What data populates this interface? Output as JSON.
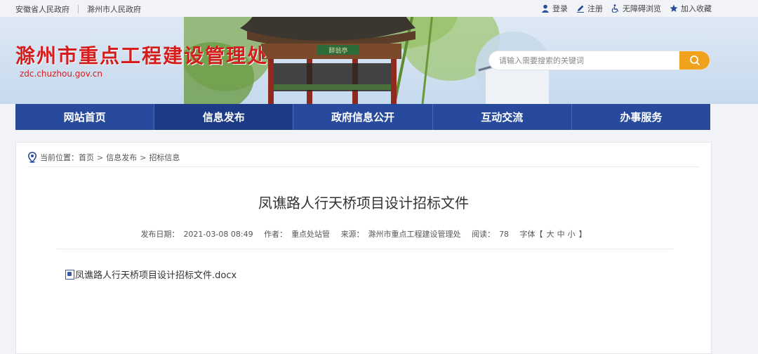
{
  "topbar": {
    "links_left": [
      "安徽省人民政府",
      "滁州市人民政府"
    ],
    "links_right": [
      {
        "label": "登录",
        "icon": "user-icon"
      },
      {
        "label": "注册",
        "icon": "pencil-icon"
      },
      {
        "label": "无障碍浏览",
        "icon": "accessibility-icon"
      },
      {
        "label": "加入收藏",
        "icon": "star-icon"
      }
    ]
  },
  "header": {
    "title": "滁州市重点工程建设管理处",
    "url": "zdc.chuzhou.gov.cn",
    "banner_sign": "醉翁亭",
    "search_placeholder": "请输入需要搜索的关键词"
  },
  "nav": {
    "items": [
      "网站首页",
      "信息发布",
      "政府信息公开",
      "互动交流",
      "办事服务"
    ],
    "active": "信息发布"
  },
  "breadcrumb": {
    "prefix": "当前位置：",
    "items": [
      "首页",
      "信息发布",
      "招标信息"
    ],
    "sep": ">"
  },
  "article": {
    "title": "凤谯路人行天桥项目设计招标文件",
    "meta": {
      "date_label": "发布日期：",
      "date": "2021-03-08 08:49",
      "author_label": "作者：",
      "author": "重点处站管",
      "source_label": "来源：",
      "source": "滁州市重点工程建设管理处",
      "reads_label": "阅读：",
      "reads": "78",
      "font_label": "字体【",
      "font_sizes": [
        "大",
        "中",
        "小"
      ],
      "font_end": "】"
    },
    "attachment": "凤谯路人行天桥项目设计招标文件.docx"
  },
  "colors": {
    "nav_bg": "#274a9c",
    "title_red": "#d41e1e",
    "search_btn": "#f0a21c"
  }
}
